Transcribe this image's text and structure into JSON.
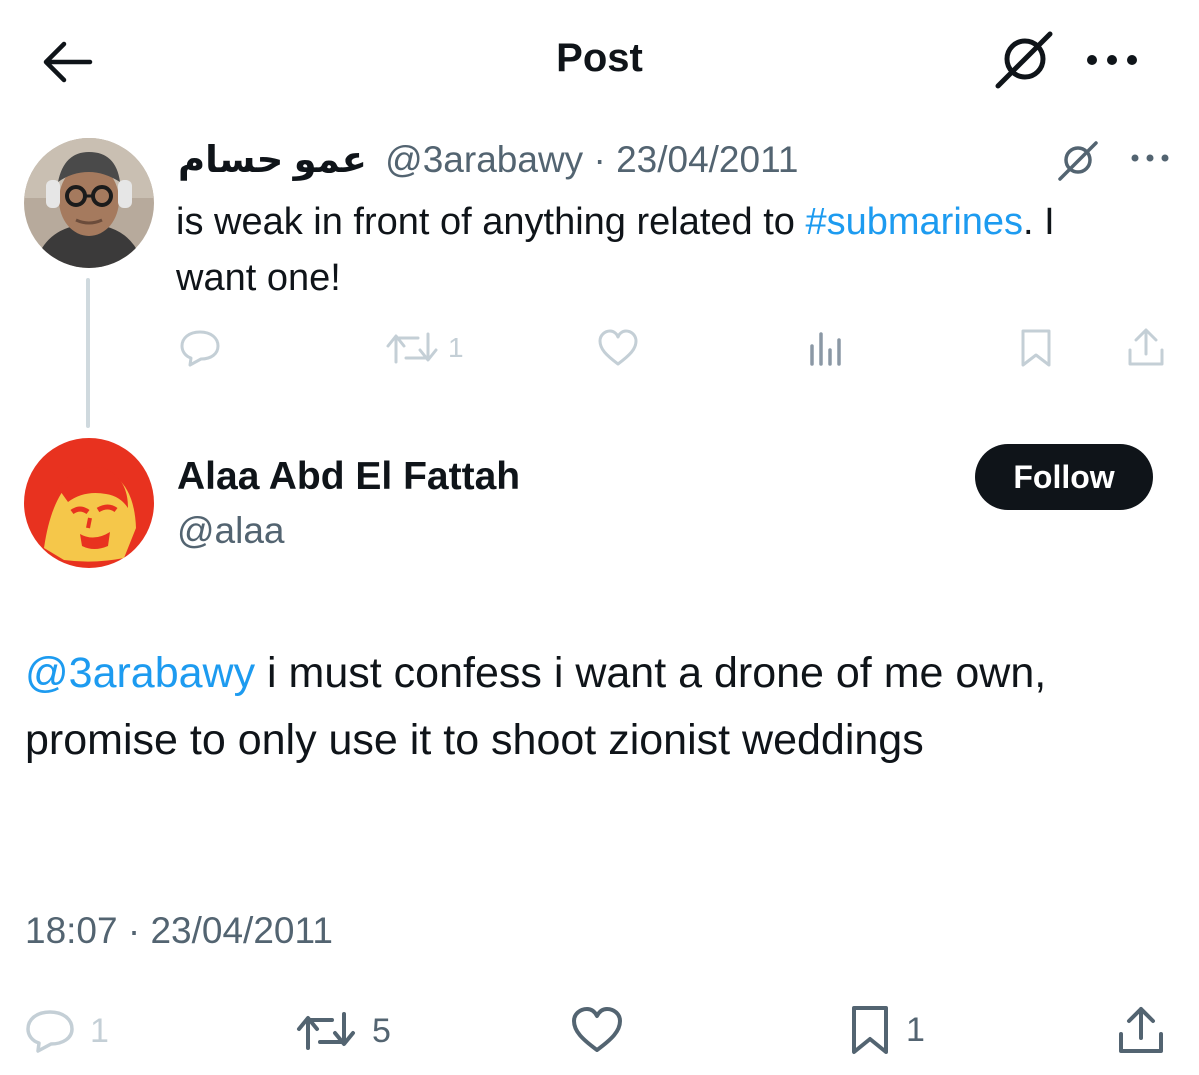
{
  "header": {
    "title": "Post",
    "back_icon": "arrow-left-icon",
    "grok_icon": "grok-icon",
    "more_icon": "more-horizontal-icon"
  },
  "parent_tweet": {
    "display_name": "عمو حسام",
    "handle": "@3arabawy",
    "separator": "·",
    "date": "23/04/2011",
    "text_before": "is weak in front of anything related to ",
    "hashtag": "#submarines",
    "text_after": ". I want one!",
    "actions": {
      "reply_icon": "reply-icon",
      "retweet_icon": "retweet-icon",
      "retweet_count": "1",
      "like_icon": "heart-icon",
      "views_icon": "analytics-icon",
      "bookmark_icon": "bookmark-icon",
      "share_icon": "share-icon"
    }
  },
  "main_tweet": {
    "display_name": "Alaa Abd El Fattah",
    "handle": "@alaa",
    "follow_label": "Follow",
    "mention": "@3arabawy",
    "text": " i must confess i want a drone of me own, promise to only use it to shoot zionist weddings",
    "timestamp": "18:07 · 23/04/2011",
    "actions": {
      "reply_count": "1",
      "retweet_count": "5",
      "like_count": "",
      "bookmark_count": "1"
    }
  },
  "colors": {
    "text": "#0f1419",
    "secondary": "#536471",
    "link": "#1d9bf0",
    "faint": "#c4cfd6",
    "button": "#0f1419"
  }
}
